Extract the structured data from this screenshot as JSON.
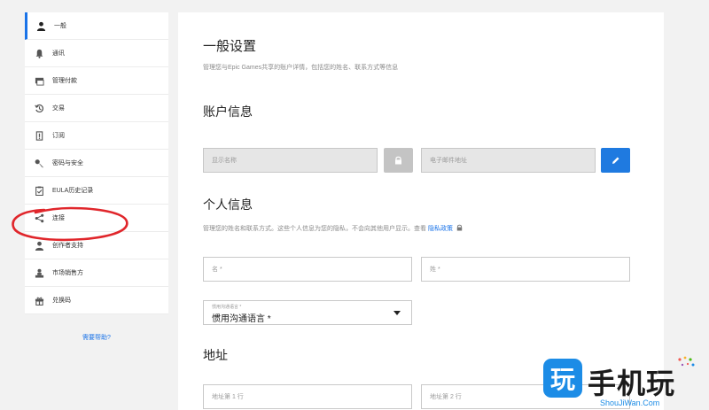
{
  "sidebar": {
    "items": [
      {
        "label": "一般",
        "icon": "person-icon",
        "active": true
      },
      {
        "label": "通讯",
        "icon": "bell-icon"
      },
      {
        "label": "管理付款",
        "icon": "payment-icon"
      },
      {
        "label": "交易",
        "icon": "history-icon"
      },
      {
        "label": "订阅",
        "icon": "subscription-icon"
      },
      {
        "label": "密码与安全",
        "icon": "key-icon"
      },
      {
        "label": "EULA历史记录",
        "icon": "clipboard-check-icon"
      },
      {
        "label": "连接",
        "icon": "share-icon"
      },
      {
        "label": "创作者支持",
        "icon": "creator-icon"
      },
      {
        "label": "市场销售方",
        "icon": "seller-icon"
      },
      {
        "label": "兑换码",
        "icon": "gift-icon"
      }
    ],
    "help": "需要帮助?"
  },
  "main": {
    "title": "一般设置",
    "description": "管理您与Epic Games共享的账户详情，包括您的姓名、联系方式等信息",
    "account": {
      "heading": "账户信息",
      "display_name_placeholder": "显示名称",
      "email_placeholder": "电子邮件地址"
    },
    "personal": {
      "heading": "个人信息",
      "note": "管理您的姓名和联系方式。这些个人信息为您的隐私，不会向其他用户显示。查看",
      "privacy_link": "隐私政策",
      "first_name_placeholder": "名 *",
      "last_name_placeholder": "姓 *",
      "language_small_label": "惯用沟通语言 *",
      "language_value": "惯用沟通语言 *"
    },
    "address": {
      "heading": "地址",
      "line1_placeholder": "地址第 1 行",
      "line2_placeholder": "地址第 2 行"
    }
  },
  "watermark": {
    "logo_char": "玩",
    "text": "手机玩",
    "url": "ShouJiWan.Com"
  },
  "colors": {
    "accent": "#1f7ae0",
    "annotation": "#e0262b",
    "watermark": "#1c8ce6"
  }
}
